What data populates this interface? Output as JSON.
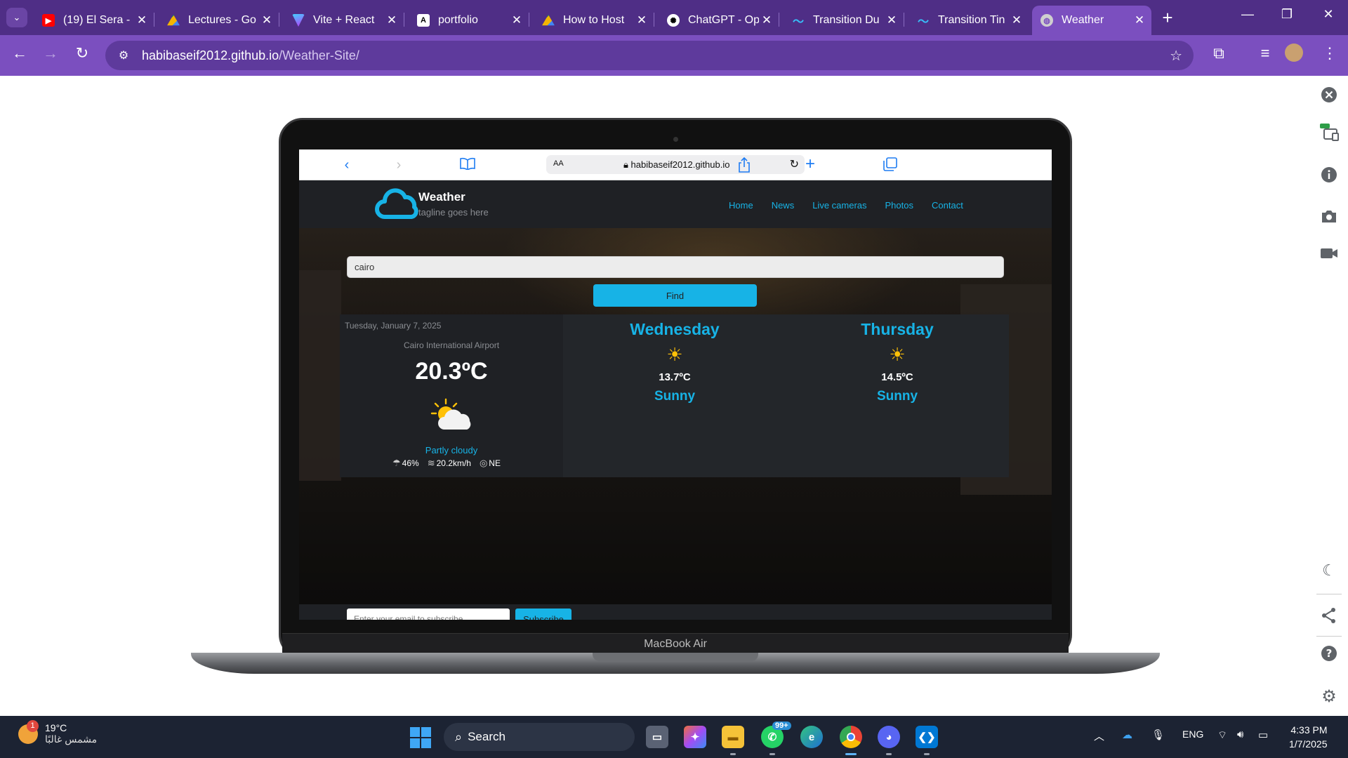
{
  "browser": {
    "tabs": [
      {
        "title": "(19) El Sera -",
        "favicon": "youtube-icon",
        "color": "#ff0000"
      },
      {
        "title": "Lectures - Go",
        "favicon": "drive-icon",
        "color": "#f4b400"
      },
      {
        "title": "Vite + React",
        "favicon": "vite-icon",
        "color": "#a259ff"
      },
      {
        "title": "portfolio",
        "favicon": "aceternity-icon",
        "color": "#000000"
      },
      {
        "title": "How to Host",
        "favicon": "drive-icon",
        "color": "#f4b400"
      },
      {
        "title": "ChatGPT - Op",
        "favicon": "chatgpt-icon",
        "color": "#000000"
      },
      {
        "title": "Transition Du",
        "favicon": "tailwind-icon",
        "color": "#38bdf8"
      },
      {
        "title": "Transition Tin",
        "favicon": "tailwind-icon",
        "color": "#38bdf8"
      },
      {
        "title": "Weather",
        "favicon": "globe-icon",
        "color": "#cfcfcf"
      }
    ],
    "url_host": "habibaseif2012.github.io",
    "url_path": "/Weather-Site/"
  },
  "device": {
    "label": "MacBook Air",
    "safari_domain": "habibaseif2012.github.io",
    "safari_aa": "AA"
  },
  "site": {
    "brand": "Weather",
    "tagline": "tagline goes here",
    "nav": [
      "Home",
      "News",
      "Live cameras",
      "Photos",
      "Contact"
    ],
    "search_value": "cairo",
    "find_label": "Find",
    "today": {
      "date": "Tuesday, January 7, 2025",
      "location": "Cairo International Airport",
      "temp": "20.3ºC",
      "condition": "Partly cloudy",
      "humidity": "46%",
      "wind_speed": "20.2km/h",
      "wind_dir": "NE"
    },
    "forecast": [
      {
        "day": "Wednesday",
        "temp": "13.7ºC",
        "condition": "Sunny"
      },
      {
        "day": "Thursday",
        "temp": "14.5ºC",
        "condition": "Sunny"
      }
    ],
    "subscribe_placeholder": "Enter your email to subscribe",
    "subscribe_label": "Subscribe",
    "accent": "#17b3e6"
  },
  "taskbar": {
    "weather_temp": "19°C",
    "weather_desc": "مشمس غالبًا",
    "notification_count": "1",
    "search_label": "Search",
    "whatsapp_badge": "99+",
    "lang": "ENG",
    "time": "4:33 PM",
    "date": "1/7/2025"
  }
}
